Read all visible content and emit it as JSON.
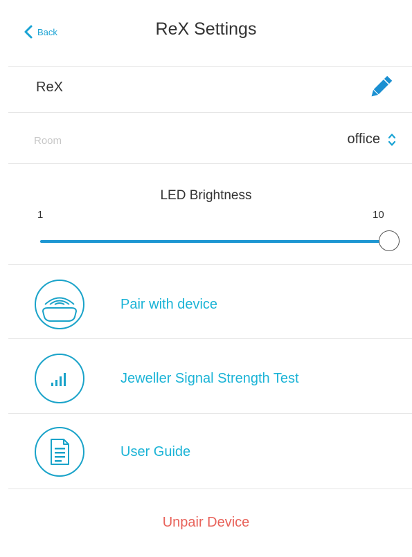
{
  "header": {
    "back_label": "Back",
    "title": "ReX Settings"
  },
  "device": {
    "name": "ReX"
  },
  "room": {
    "label": "Room",
    "value": "office"
  },
  "led_brightness": {
    "title": "LED Brightness",
    "min_label": "1",
    "max_label": "10",
    "min": 1,
    "max": 10,
    "value": 10
  },
  "actions": [
    {
      "label": "Pair with device",
      "icon": "pair-device-icon"
    },
    {
      "label": "Jeweller Signal Strength Test",
      "icon": "signal-strength-icon"
    },
    {
      "label": "User Guide",
      "icon": "user-guide-icon"
    }
  ],
  "unpair_label": "Unpair Device",
  "colors": {
    "accent": "#1aa3d4",
    "slider_fill": "#1d96d2",
    "danger": "#e8625a",
    "divider": "#e6e6e6"
  }
}
